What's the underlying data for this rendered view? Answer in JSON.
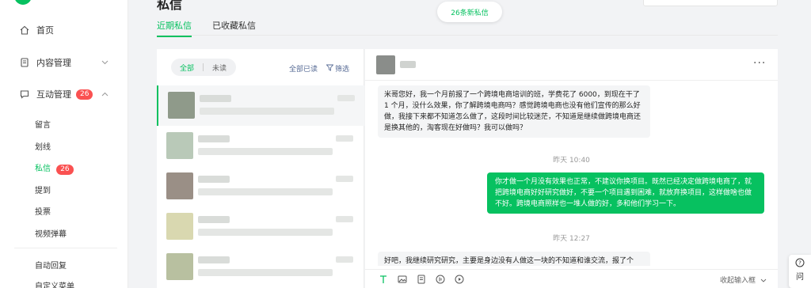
{
  "sidebar": {
    "home": "首页",
    "content_mgmt": "内容管理",
    "interaction_mgmt": "互动管理",
    "interaction_badge": "26",
    "sub_items": [
      "留言",
      "划线",
      "私信",
      "提到",
      "投票",
      "视频弹幕"
    ],
    "dm_badge": "26",
    "auto_reply": "自动回复",
    "custom_menu": "自定义菜单"
  },
  "header": {
    "title": "私信",
    "new_messages_pill": "26条新私信",
    "tabs": [
      "近期私信",
      "已收藏私信"
    ]
  },
  "list": {
    "filter_all": "全部",
    "filter_unread": "未读",
    "mark_all_read": "全部已读",
    "filter": "筛选",
    "avatar_colors": [
      "#8f9a8a",
      "#b9c9b8",
      "#9a8f86",
      "#d9d8b0",
      "#b8c0a0"
    ]
  },
  "chat": {
    "incoming_1": "米哥您好，我一个月前报了一个跨境电商培训的班，学费花了 6000，到现在干了 1 个月，没什么效果，你了解跨境电商吗？感觉跨境电商也没有他们宣传的那么好做，我接下来都不知道怎么做了，这段时间比较迷茫，不知道是继续做跨境电商还是换其他的，淘客现在好做吗？我可以做吗？",
    "time_1": "昨天 10:40",
    "outgoing_1": "你才做一个月没有效果也正常，不建议你换项目。既然已经决定做跨境电商了，就把跨境电商好好研究做好，不要一个项目遇到困难，就放弃换项目，这样做啥也做不好。跨境电商照样也一堆人做的好，多和他们学习一下。",
    "time_2": "昨天 12:27",
    "incoming_2": "好吧，我继续研究研究，主要是身边没有人做这一块的不知道和谁交流，报了个",
    "collapse_input": "收起输入框",
    "more": "···"
  },
  "fab": {
    "label": "问"
  },
  "colors": {
    "accent": "#07c160",
    "badge": "#fa5151",
    "link": "#576b95"
  }
}
